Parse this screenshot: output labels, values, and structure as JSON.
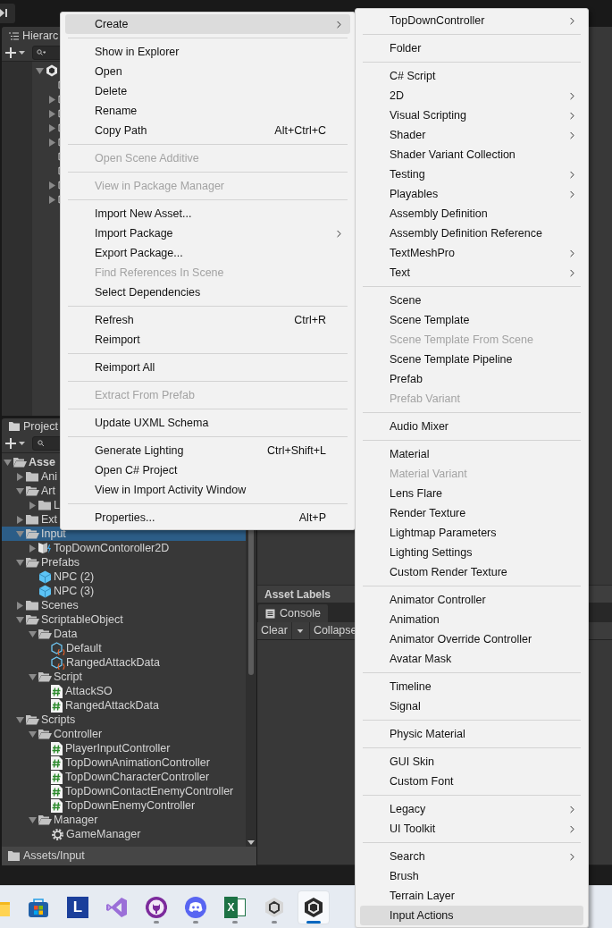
{
  "hierarchy": {
    "tab": "Hierarc",
    "tree": [
      {
        "kind": "scene",
        "expanded": true,
        "children": [
          {
            "kind": "object"
          },
          {
            "kind": "object",
            "expanded": false
          },
          {
            "kind": "object",
            "expanded": false
          },
          {
            "kind": "object",
            "expanded": false
          },
          {
            "kind": "object",
            "expanded": false
          },
          {
            "kind": "object"
          },
          {
            "kind": "object"
          },
          {
            "kind": "object",
            "expanded": false
          },
          {
            "kind": "object",
            "expanded": false
          }
        ]
      }
    ]
  },
  "project": {
    "tab": "Project",
    "tree": [
      {
        "label": "Asse",
        "kind": "folder",
        "expanded": true,
        "selected": false,
        "children": [
          {
            "label": "Ani",
            "kind": "folder",
            "expanded": false,
            "selected": false
          },
          {
            "label": "Art",
            "kind": "folder",
            "expanded": true,
            "selected": false,
            "children": [
              {
                "label": "L",
                "kind": "folder",
                "expanded": false,
                "selected": false
              }
            ]
          },
          {
            "label": "Ext",
            "kind": "folder",
            "expanded": false,
            "selected": false
          },
          {
            "label": "Input",
            "kind": "folder",
            "expanded": true,
            "selected": true,
            "children": [
              {
                "label": "TopDownContoroller2D",
                "kind": "input",
                "expanded": false,
                "selected": false
              }
            ]
          },
          {
            "label": "Prefabs",
            "kind": "folder",
            "expanded": true,
            "selected": false,
            "children": [
              {
                "label": "NPC (2)",
                "kind": "prefab",
                "selected": false
              },
              {
                "label": "NPC (3)",
                "kind": "prefab",
                "selected": false
              }
            ]
          },
          {
            "label": "Scenes",
            "kind": "folder",
            "expanded": false,
            "selected": false
          },
          {
            "label": "ScriptableObject",
            "kind": "folder",
            "expanded": true,
            "selected": false,
            "children": [
              {
                "label": "Data",
                "kind": "folder",
                "expanded": true,
                "selected": false,
                "children": [
                  {
                    "label": "Default",
                    "kind": "so",
                    "selected": false
                  },
                  {
                    "label": "RangedAttackData",
                    "kind": "so",
                    "selected": false
                  }
                ]
              },
              {
                "label": "Script",
                "kind": "folder",
                "expanded": true,
                "selected": false,
                "children": [
                  {
                    "label": "AttackSO",
                    "kind": "script",
                    "selected": false
                  },
                  {
                    "label": "RangedAttackData",
                    "kind": "script",
                    "selected": false
                  }
                ]
              }
            ]
          },
          {
            "label": "Scripts",
            "kind": "folder",
            "expanded": true,
            "selected": false,
            "children": [
              {
                "label": "Controller",
                "kind": "folder",
                "expanded": true,
                "selected": false,
                "children": [
                  {
                    "label": "PlayerInputController",
                    "kind": "script",
                    "selected": false
                  },
                  {
                    "label": "TopDownAnimationController",
                    "kind": "script",
                    "selected": false
                  },
                  {
                    "label": "TopDownCharacterController",
                    "kind": "script",
                    "selected": false
                  },
                  {
                    "label": "TopDownContactEnemyController",
                    "kind": "script",
                    "selected": false
                  },
                  {
                    "label": "TopDownEnemyController",
                    "kind": "script",
                    "selected": false
                  }
                ]
              },
              {
                "label": "Manager",
                "kind": "folder",
                "expanded": true,
                "selected": false,
                "children": [
                  {
                    "label": "GameManager",
                    "kind": "gear",
                    "selected": false
                  }
                ]
              }
            ]
          }
        ]
      }
    ],
    "path": "Assets/Input"
  },
  "inspector": {
    "asset_labels": "Asset Labels"
  },
  "console": {
    "tab": "Console",
    "clear": "Clear",
    "collapse": "Collapse"
  },
  "context_menu": {
    "items": [
      {
        "kind": "item",
        "label": "Create",
        "submenu": true,
        "disabled": false,
        "selected": true
      },
      {
        "kind": "separator"
      },
      {
        "kind": "item",
        "label": "Show in Explorer",
        "submenu": false,
        "disabled": false,
        "selected": false
      },
      {
        "kind": "item",
        "label": "Open",
        "submenu": false,
        "disabled": false,
        "selected": false
      },
      {
        "kind": "item",
        "label": "Delete",
        "submenu": false,
        "disabled": false,
        "selected": false
      },
      {
        "kind": "item",
        "label": "Rename",
        "submenu": false,
        "disabled": false,
        "selected": false
      },
      {
        "kind": "item",
        "label": "Copy Path",
        "shortcut": "Alt+Ctrl+C",
        "submenu": false,
        "disabled": false,
        "selected": false
      },
      {
        "kind": "separator"
      },
      {
        "kind": "item",
        "label": "Open Scene Additive",
        "submenu": false,
        "disabled": true,
        "selected": false
      },
      {
        "kind": "separator"
      },
      {
        "kind": "item",
        "label": "View in Package Manager",
        "submenu": false,
        "disabled": true,
        "selected": false
      },
      {
        "kind": "separator"
      },
      {
        "kind": "item",
        "label": "Import New Asset...",
        "submenu": false,
        "disabled": false,
        "selected": false
      },
      {
        "kind": "item",
        "label": "Import Package",
        "submenu": true,
        "disabled": false,
        "selected": false
      },
      {
        "kind": "item",
        "label": "Export Package...",
        "submenu": false,
        "disabled": false,
        "selected": false
      },
      {
        "kind": "item",
        "label": "Find References In Scene",
        "submenu": false,
        "disabled": true,
        "selected": false
      },
      {
        "kind": "item",
        "label": "Select Dependencies",
        "submenu": false,
        "disabled": false,
        "selected": false
      },
      {
        "kind": "separator"
      },
      {
        "kind": "item",
        "label": "Refresh",
        "shortcut": "Ctrl+R",
        "submenu": false,
        "disabled": false,
        "selected": false
      },
      {
        "kind": "item",
        "label": "Reimport",
        "submenu": false,
        "disabled": false,
        "selected": false
      },
      {
        "kind": "separator"
      },
      {
        "kind": "item",
        "label": "Reimport All",
        "submenu": false,
        "disabled": false,
        "selected": false
      },
      {
        "kind": "separator"
      },
      {
        "kind": "item",
        "label": "Extract From Prefab",
        "submenu": false,
        "disabled": true,
        "selected": false
      },
      {
        "kind": "separator"
      },
      {
        "kind": "item",
        "label": "Update UXML Schema",
        "submenu": false,
        "disabled": false,
        "selected": false
      },
      {
        "kind": "separator"
      },
      {
        "kind": "item",
        "label": "Generate Lighting",
        "shortcut": "Ctrl+Shift+L",
        "submenu": false,
        "disabled": false,
        "selected": false
      },
      {
        "kind": "item",
        "label": "Open C# Project",
        "submenu": false,
        "disabled": false,
        "selected": false
      },
      {
        "kind": "item",
        "label": "View in Import Activity Window",
        "submenu": false,
        "disabled": false,
        "selected": false
      },
      {
        "kind": "separator"
      },
      {
        "kind": "item",
        "label": "Properties...",
        "shortcut": "Alt+P",
        "submenu": false,
        "disabled": false,
        "selected": false
      }
    ]
  },
  "create_submenu": {
    "items": [
      {
        "kind": "item",
        "label": "TopDownController",
        "submenu": true,
        "disabled": false,
        "selected": false
      },
      {
        "kind": "separator"
      },
      {
        "kind": "item",
        "label": "Folder",
        "submenu": false,
        "disabled": false,
        "selected": false
      },
      {
        "kind": "separator"
      },
      {
        "kind": "item",
        "label": "C# Script",
        "submenu": false,
        "disabled": false,
        "selected": false
      },
      {
        "kind": "item",
        "label": "2D",
        "submenu": true,
        "disabled": false,
        "selected": false
      },
      {
        "kind": "item",
        "label": "Visual Scripting",
        "submenu": true,
        "disabled": false,
        "selected": false
      },
      {
        "kind": "item",
        "label": "Shader",
        "submenu": true,
        "disabled": false,
        "selected": false
      },
      {
        "kind": "item",
        "label": "Shader Variant Collection",
        "submenu": false,
        "disabled": false,
        "selected": false
      },
      {
        "kind": "item",
        "label": "Testing",
        "submenu": true,
        "disabled": false,
        "selected": false
      },
      {
        "kind": "item",
        "label": "Playables",
        "submenu": true,
        "disabled": false,
        "selected": false
      },
      {
        "kind": "item",
        "label": "Assembly Definition",
        "submenu": false,
        "disabled": false,
        "selected": false
      },
      {
        "kind": "item",
        "label": "Assembly Definition Reference",
        "submenu": false,
        "disabled": false,
        "selected": false
      },
      {
        "kind": "item",
        "label": "TextMeshPro",
        "submenu": true,
        "disabled": false,
        "selected": false
      },
      {
        "kind": "item",
        "label": "Text",
        "submenu": true,
        "disabled": false,
        "selected": false
      },
      {
        "kind": "separator"
      },
      {
        "kind": "item",
        "label": "Scene",
        "submenu": false,
        "disabled": false,
        "selected": false
      },
      {
        "kind": "item",
        "label": "Scene Template",
        "submenu": false,
        "disabled": false,
        "selected": false
      },
      {
        "kind": "item",
        "label": "Scene Template From Scene",
        "submenu": false,
        "disabled": true,
        "selected": false
      },
      {
        "kind": "item",
        "label": "Scene Template Pipeline",
        "submenu": false,
        "disabled": false,
        "selected": false
      },
      {
        "kind": "item",
        "label": "Prefab",
        "submenu": false,
        "disabled": false,
        "selected": false
      },
      {
        "kind": "item",
        "label": "Prefab Variant",
        "submenu": false,
        "disabled": true,
        "selected": false
      },
      {
        "kind": "separator"
      },
      {
        "kind": "item",
        "label": "Audio Mixer",
        "submenu": false,
        "disabled": false,
        "selected": false
      },
      {
        "kind": "separator"
      },
      {
        "kind": "item",
        "label": "Material",
        "submenu": false,
        "disabled": false,
        "selected": false
      },
      {
        "kind": "item",
        "label": "Material Variant",
        "submenu": false,
        "disabled": true,
        "selected": false
      },
      {
        "kind": "item",
        "label": "Lens Flare",
        "submenu": false,
        "disabled": false,
        "selected": false
      },
      {
        "kind": "item",
        "label": "Render Texture",
        "submenu": false,
        "disabled": false,
        "selected": false
      },
      {
        "kind": "item",
        "label": "Lightmap Parameters",
        "submenu": false,
        "disabled": false,
        "selected": false
      },
      {
        "kind": "item",
        "label": "Lighting Settings",
        "submenu": false,
        "disabled": false,
        "selected": false
      },
      {
        "kind": "item",
        "label": "Custom Render Texture",
        "submenu": false,
        "disabled": false,
        "selected": false
      },
      {
        "kind": "separator"
      },
      {
        "kind": "item",
        "label": "Animator Controller",
        "submenu": false,
        "disabled": false,
        "selected": false
      },
      {
        "kind": "item",
        "label": "Animation",
        "submenu": false,
        "disabled": false,
        "selected": false
      },
      {
        "kind": "item",
        "label": "Animator Override Controller",
        "submenu": false,
        "disabled": false,
        "selected": false
      },
      {
        "kind": "item",
        "label": "Avatar Mask",
        "submenu": false,
        "disabled": false,
        "selected": false
      },
      {
        "kind": "separator"
      },
      {
        "kind": "item",
        "label": "Timeline",
        "submenu": false,
        "disabled": false,
        "selected": false
      },
      {
        "kind": "item",
        "label": "Signal",
        "submenu": false,
        "disabled": false,
        "selected": false
      },
      {
        "kind": "separator"
      },
      {
        "kind": "item",
        "label": "Physic Material",
        "submenu": false,
        "disabled": false,
        "selected": false
      },
      {
        "kind": "separator"
      },
      {
        "kind": "item",
        "label": "GUI Skin",
        "submenu": false,
        "disabled": false,
        "selected": false
      },
      {
        "kind": "item",
        "label": "Custom Font",
        "submenu": false,
        "disabled": false,
        "selected": false
      },
      {
        "kind": "separator"
      },
      {
        "kind": "item",
        "label": "Legacy",
        "submenu": true,
        "disabled": false,
        "selected": false
      },
      {
        "kind": "item",
        "label": "UI Toolkit",
        "submenu": true,
        "disabled": false,
        "selected": false
      },
      {
        "kind": "separator"
      },
      {
        "kind": "item",
        "label": "Search",
        "submenu": true,
        "disabled": false,
        "selected": false
      },
      {
        "kind": "item",
        "label": "Brush",
        "submenu": false,
        "disabled": false,
        "selected": false
      },
      {
        "kind": "item",
        "label": "Terrain Layer",
        "submenu": false,
        "disabled": false,
        "selected": false
      },
      {
        "kind": "item",
        "label": "Input Actions",
        "submenu": false,
        "disabled": false,
        "selected": true
      }
    ]
  },
  "taskbar": {
    "apps": [
      {
        "kind": "explorer",
        "running": false,
        "active": false
      },
      {
        "kind": "store",
        "running": false,
        "active": false
      },
      {
        "kind": "letter",
        "label": "L",
        "running": false,
        "active": false
      },
      {
        "kind": "vs",
        "running": false,
        "active": false
      },
      {
        "kind": "github",
        "running": true,
        "active": false
      },
      {
        "kind": "discord",
        "running": true,
        "active": false
      },
      {
        "kind": "excel",
        "label": "X",
        "running": true,
        "active": false
      },
      {
        "kind": "unity-hub",
        "running": true,
        "active": false
      },
      {
        "kind": "unity",
        "running": false,
        "active": true
      }
    ]
  }
}
